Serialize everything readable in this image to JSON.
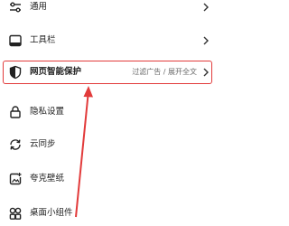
{
  "settings": {
    "items": [
      {
        "label": "通用",
        "icon": "sliders-icon"
      },
      {
        "label": "工具栏",
        "icon": "toolbar-icon"
      },
      {
        "label": "网页智能保护",
        "hint": "过滤广告 / 展开全文",
        "icon": "shield-icon"
      },
      {
        "label": "隐私设置",
        "icon": "lock-icon"
      },
      {
        "label": "云同步",
        "icon": "sync-icon"
      },
      {
        "label": "夸克壁纸",
        "icon": "wallpaper-icon"
      },
      {
        "label": "桌面小组件",
        "icon": "widgets-icon"
      }
    ]
  },
  "annotation": {
    "highlight_color": "#e23b3b"
  }
}
